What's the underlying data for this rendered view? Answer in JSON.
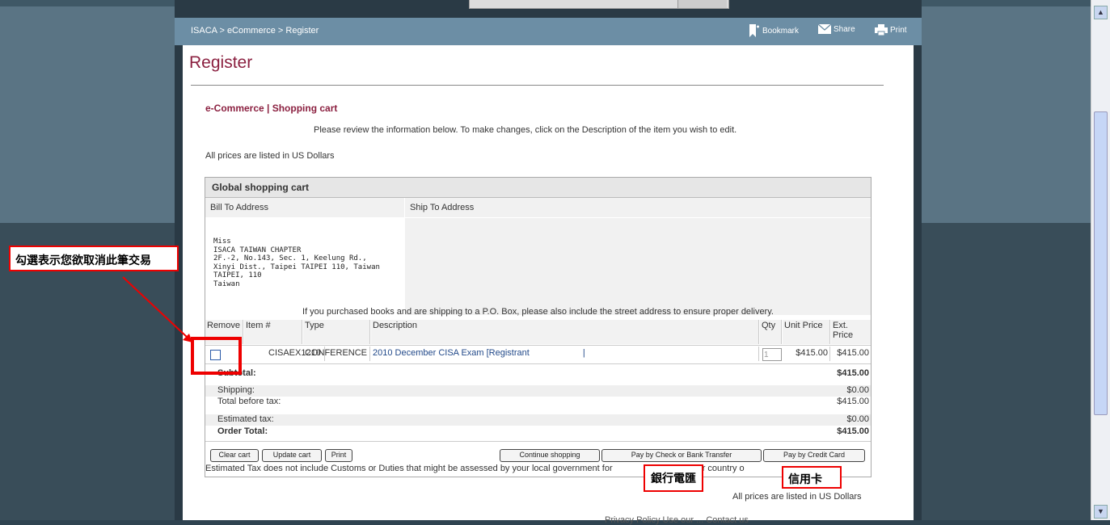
{
  "breadcrumb": "ISACA > eCommerce > Register",
  "tools": {
    "bookmark": "Bookmark",
    "share": "Share",
    "print": "Print"
  },
  "page": {
    "title": "Register",
    "subtitle": "e-Commerce | Shopping cart",
    "review_note": "Please review the information below. To make changes, click on the Description of the item you wish to edit.",
    "prices_note": "All prices are listed in US Dollars"
  },
  "cart": {
    "title": "Global shopping cart",
    "bill_to_label": "Bill To Address",
    "ship_to_label": "Ship To Address",
    "bill_to_lines": [
      "Miss",
      "ISACA TAIWAN CHAPTER",
      "2F.-2, No.143, Sec. 1, Keelung Rd.,",
      "Xinyi Dist., Taipei TAIPEI 110, Taiwan",
      "TAIPEI, 110",
      "Taiwan"
    ],
    "po_box_note": "If you purchased books and are shipping to a P.O. Box, please also include the street address to ensure proper delivery.",
    "columns": {
      "remove": "Remove",
      "item": "Item #",
      "type": "Type",
      "description": "Description",
      "qty": "Qty",
      "unit_price": "Unit Price",
      "ext_price_1": "Ext.",
      "ext_price_2": "Price"
    },
    "item": {
      "item_no": "CISAEX1210",
      "type": "CONFERENCE",
      "description": "2010 December CISA Exam [Registrant",
      "qty": "1",
      "unit_price": "$415.00",
      "ext_price": "$415.00"
    },
    "summary": {
      "subtotal_label": "Subtotal:",
      "subtotal": "$415.00",
      "shipping_label": "Shipping:",
      "shipping": "$0.00",
      "before_tax_label": "Total before tax:",
      "before_tax": "$415.00",
      "est_tax_label": "Estimated tax:",
      "est_tax": "$0.00",
      "order_total_label": "Order Total:",
      "order_total": "$415.00"
    },
    "buttons": {
      "clear": "Clear cart",
      "update": "Update cart",
      "print": "Print",
      "continue": "Continue shopping",
      "pay_check": "Pay by Check or Bank Transfer",
      "pay_card": "Pay by Credit Card"
    },
    "tax_note_start": "Estimated Tax does not include Customs or Duties that might be assessed by your local government for",
    "tax_note_end": "nto your country o"
  },
  "annotations": {
    "remove_hint": "勾選表示您欲取消此筆交易",
    "bank": "銀行電匯",
    "card": "信用卡"
  },
  "footer_fragment": "Privacy Policy   Use our  ...   Contact us"
}
